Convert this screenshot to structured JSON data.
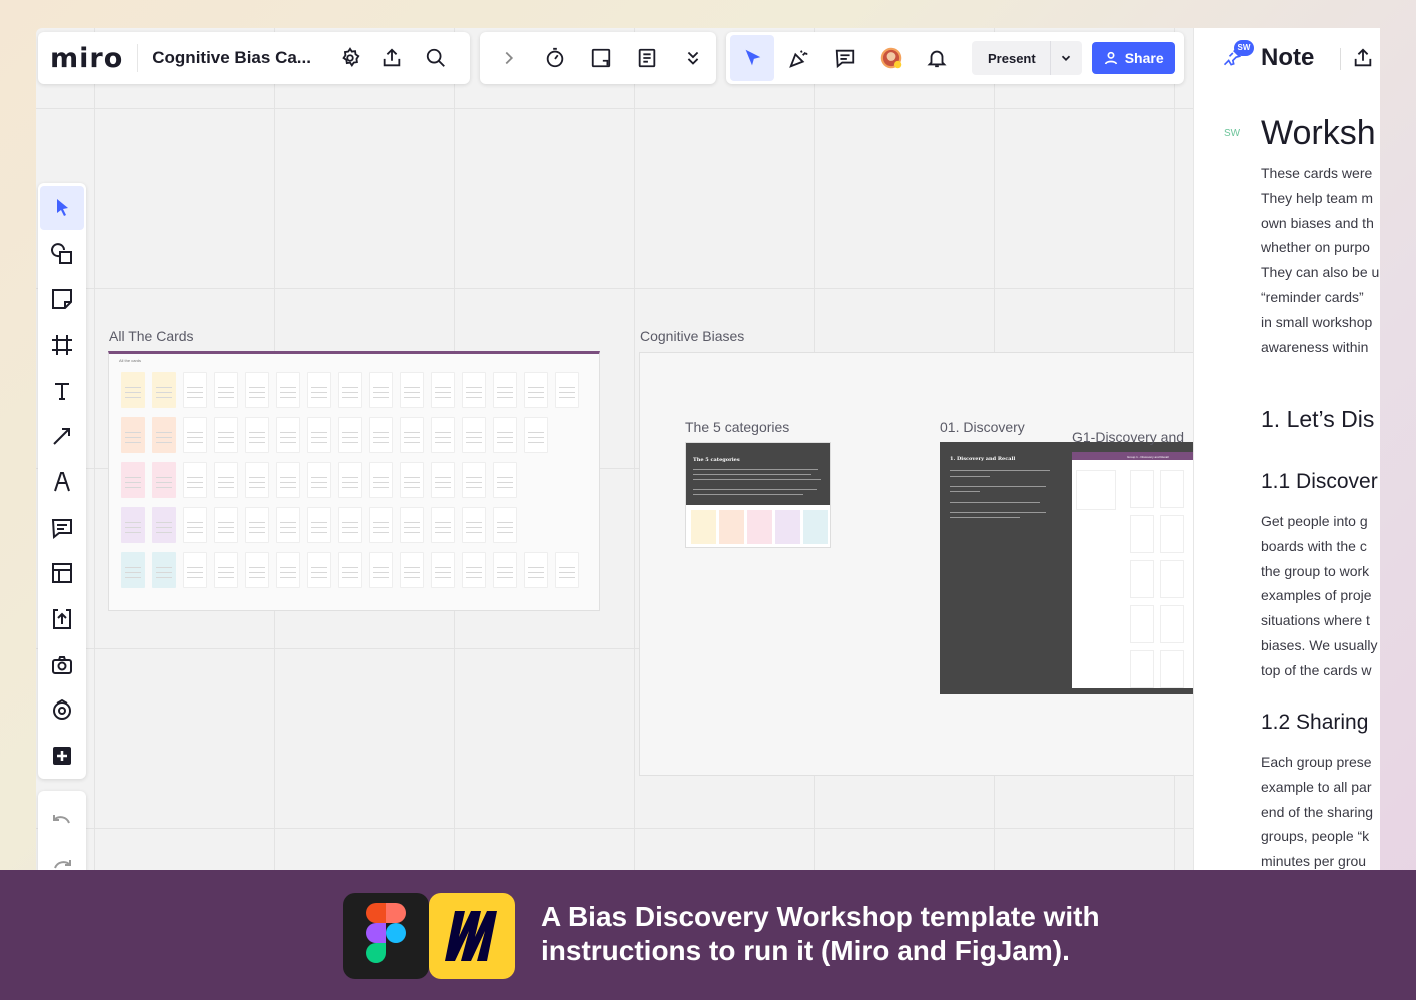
{
  "app": {
    "logo": "miro",
    "board_title": "Cognitive Bias Ca..."
  },
  "toolbar": {
    "present_label": "Present",
    "share_label": "Share"
  },
  "frames": {
    "all_cards_label": "All The Cards",
    "all_cards_header": "All the cards",
    "cognitive_biases_label": "Cognitive Biases",
    "categories_label": "The 5 categories",
    "categories_card_title": "The 5 categories",
    "discovery_label": "01. Discovery",
    "discovery_card_title": "1. Discovery and Recall",
    "g1_label": "G1-Discovery and",
    "g1_header": "Group 1 - Discovery and Recall"
  },
  "note": {
    "avatar_initials": "SW",
    "side_initials": "SW",
    "title": "Note",
    "heading": "Worksh",
    "intro_lines": [
      "These cards were",
      "They help team m",
      "own biases and th",
      "whether on purpo",
      "They can also be u",
      "“reminder cards” ",
      "in small workshop",
      "awareness within"
    ],
    "section1": "1. Let’s Dis",
    "section11": "1.1 Discover",
    "body11_lines": [
      "Get people into g",
      "boards with the c",
      "the group to work",
      "examples of proje",
      "situations where t",
      "biases. We usually",
      "top of the cards w"
    ],
    "section12": "1.2 Sharing",
    "body12_lines": [
      "Each group prese",
      "example to all par",
      "end of the sharing",
      "groups, people “k",
      "minutes per grou"
    ]
  },
  "banner": {
    "line1": "A Bias Discovery  Workshop template with",
    "line2": "instructions to run it (Miro and FigJam)."
  },
  "colors": {
    "accent": "#4262ff",
    "banner_bg": "#5a3660",
    "miro_tile": "#ffd02f",
    "figma_tile": "#1e1e1e",
    "row_colors": [
      "#fdf3d8",
      "#fde7d9",
      "#fbe3ea",
      "#efe4f5",
      "#e1f1f4"
    ]
  }
}
